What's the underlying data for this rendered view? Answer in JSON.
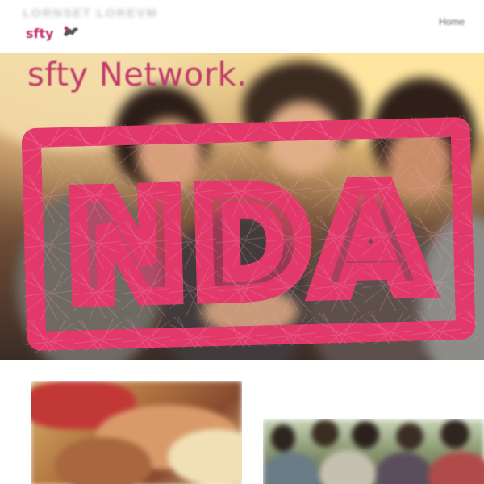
{
  "header": {
    "blurred_tagline": "LORNSET LOREVM",
    "logo_text": "sfty",
    "nav": {
      "home_label": "Home"
    }
  },
  "hero": {
    "brand_title": "sfty Network."
  },
  "stamp": {
    "text": "NDA",
    "color": "#e2386a",
    "texture_color": "#ff9fc0"
  },
  "colors": {
    "brand": "#c03b6a",
    "hero_warm": "#e9cf95",
    "hero_dark": "#3b2c26"
  },
  "icons": {
    "logo_mark": "fleur-logo-icon"
  },
  "cards": [
    {
      "name": "team-hands-photo"
    },
    {
      "name": "group-photo"
    }
  ]
}
